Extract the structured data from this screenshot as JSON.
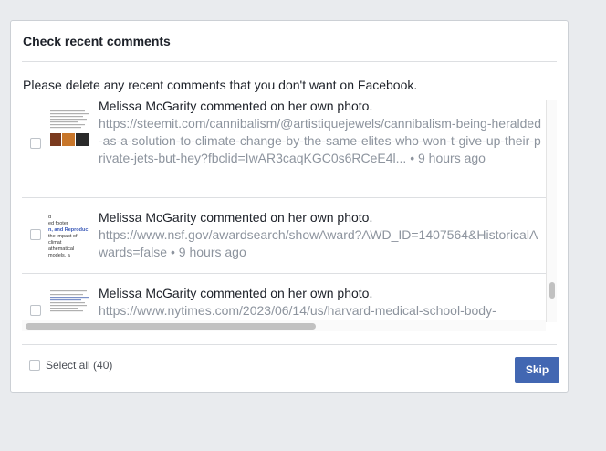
{
  "dialog": {
    "title": "Check recent comments",
    "instruction": "Please delete any recent comments that you don't want on Facebook."
  },
  "comments": [
    {
      "actor_text": "Melissa McGarity commented on her own photo.",
      "link": "https://steemit.com/cannibalism/@artistiquejewels/cannibalism-being-heralded-as-a-solution-to-climate-change-by-the-same-elites-who-won-t-give-up-their-private-jets-but-hey?fbclid=IwAR3caqKGC0s6RCeE4l...",
      "separator": "•",
      "time": "9 hours ago",
      "checked": false
    },
    {
      "actor_text": "Melissa McGarity commented on her own photo.",
      "link": "https://www.nsf.gov/awardsearch/showAward?AWD_ID=1407564&HistoricalAwards=false",
      "separator": "•",
      "time": "9 hours ago",
      "thumb_lines": [
        "d",
        "ed footer",
        "n, and Reproduc",
        "the impact of climat",
        "athematical models, a"
      ],
      "checked": false
    },
    {
      "actor_text": "Melissa McGarity commented on her own photo.",
      "link": "https://www.nytimes.com/2023/06/14/us/harvard-medical-school-body-",
      "checked": false
    }
  ],
  "footer": {
    "select_all_label": "Select all (40)",
    "skip_label": "Skip"
  },
  "colors": {
    "accent": "#4267b2",
    "link_gray": "#8d949e",
    "text": "#1d2129"
  }
}
